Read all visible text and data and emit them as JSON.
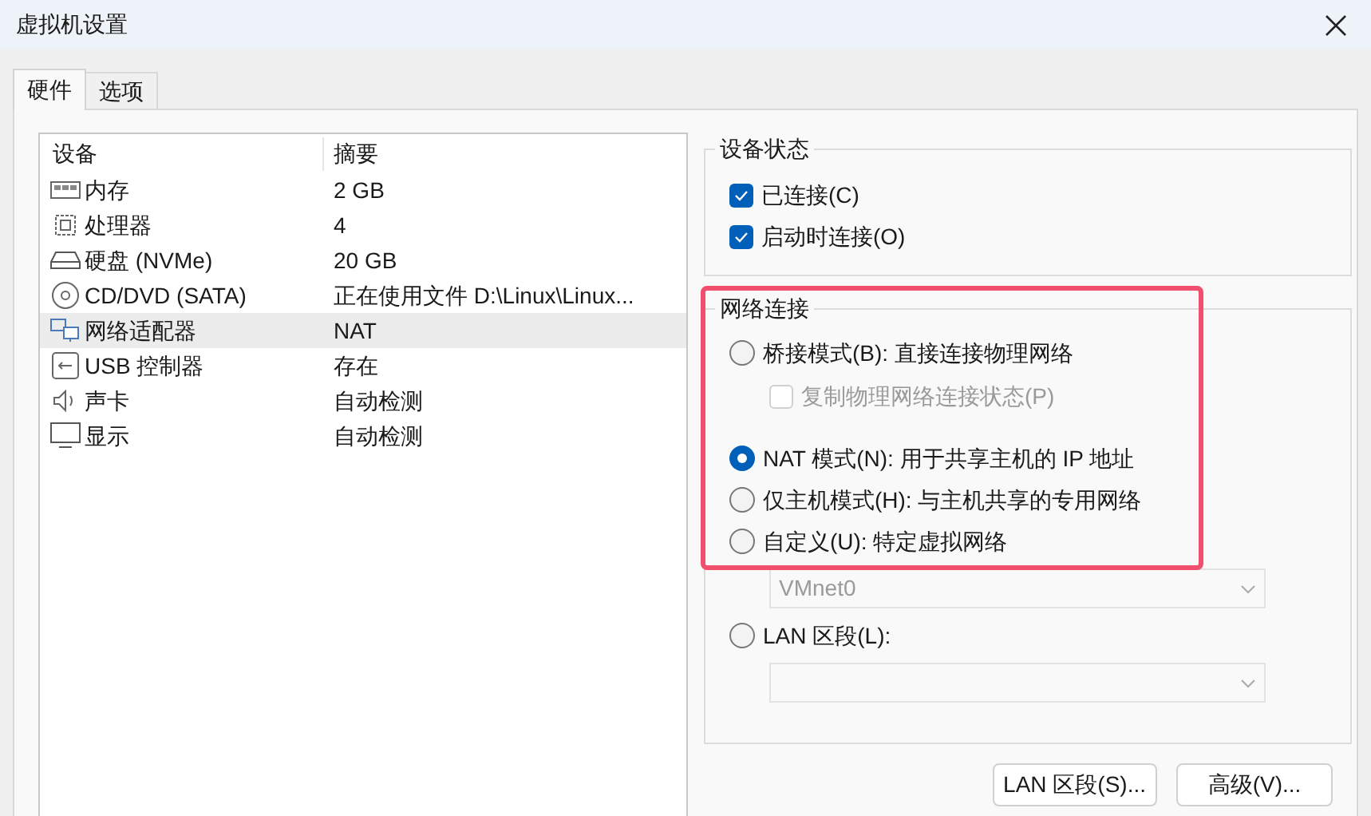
{
  "window": {
    "title": "虚拟机设置"
  },
  "tabs": [
    {
      "label": "硬件",
      "selected": true
    },
    {
      "label": "选项",
      "selected": false
    }
  ],
  "device_table": {
    "columns": [
      "设备",
      "摘要"
    ],
    "rows": [
      {
        "kind": "memory",
        "device": "内存",
        "summary": "2 GB",
        "selected": false
      },
      {
        "kind": "cpu",
        "device": "处理器",
        "summary": "4",
        "selected": false
      },
      {
        "kind": "disk",
        "device": "硬盘 (NVMe)",
        "summary": "20 GB",
        "selected": false
      },
      {
        "kind": "cd",
        "device": "CD/DVD (SATA)",
        "summary": "正在使用文件 D:\\Linux\\Linux...",
        "selected": false
      },
      {
        "kind": "network",
        "device": "网络适配器",
        "summary": "NAT",
        "selected": true
      },
      {
        "kind": "usb",
        "device": "USB 控制器",
        "summary": "存在",
        "selected": false
      },
      {
        "kind": "sound",
        "device": "声卡",
        "summary": "自动检测",
        "selected": false
      },
      {
        "kind": "display",
        "device": "显示",
        "summary": "自动检测",
        "selected": false
      }
    ]
  },
  "device_status": {
    "title": "设备状态",
    "options": [
      {
        "label": "已连接(C)",
        "checked": true
      },
      {
        "label": "启动时连接(O)",
        "checked": true
      }
    ]
  },
  "network_connection": {
    "title": "网络连接",
    "options": [
      {
        "kind": "radio",
        "label": "桥接模式(B): 直接连接物理网络",
        "selected": false
      },
      {
        "kind": "checkbox",
        "label": "复制物理网络连接状态(P)",
        "checked": false,
        "disabled": true
      },
      {
        "kind": "radio",
        "label": "NAT 模式(N): 用于共享主机的 IP 地址",
        "selected": true
      },
      {
        "kind": "radio",
        "label": "仅主机模式(H): 与主机共享的专用网络",
        "selected": false
      },
      {
        "kind": "radio",
        "label": "自定义(U): 特定虚拟网络",
        "selected": false
      },
      {
        "kind": "dropdown",
        "value": "VMnet0",
        "disabled": true
      },
      {
        "kind": "radio",
        "label": "LAN 区段(L):",
        "selected": false
      },
      {
        "kind": "dropdown",
        "disabled": true
      }
    ]
  },
  "buttons": [
    "LAN 区段(S)...",
    "高级(V)..."
  ]
}
